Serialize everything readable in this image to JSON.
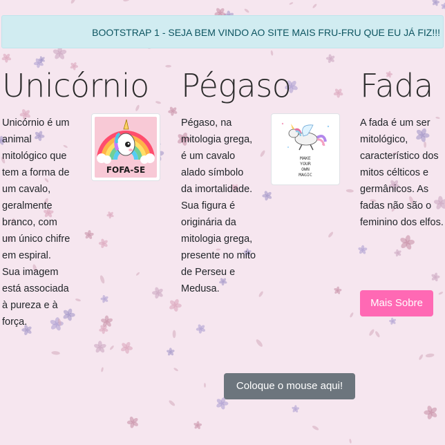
{
  "alert": {
    "text": "BOOTSTRAP 1 - SEJA BEM VINDO AO SITE MAIS FRU-FRU QUE EU JÁ FIZ!!!"
  },
  "columns": [
    {
      "title": "Unicórnio",
      "text": "Unicórnio é um animal mitológico que tem a forma de um cavalo, geralmente branco, com um único chifre em espiral. Sua imagem está associada à pureza e à força."
    },
    {
      "title": "Pégaso",
      "text": "Pégaso, na mitologia grega, é um cavalo alado símbolo da imortalidade. Sua figura é originária da mitologia grega, presente no mito de Perseu e Medusa."
    },
    {
      "title": "Fada",
      "text": "A fada é um ser mitológico, característico dos mitos célticos e germânicos. As fadas não são o feminino dos elfos."
    }
  ],
  "images": {
    "unicorn_caption": "FOFA-SE",
    "pegasus_caption_lines": [
      "MAKE",
      "YOUR",
      "OWN",
      "MAGIC"
    ]
  },
  "buttons": {
    "more": "Mais Sobre",
    "hover": "Coloque o mouse aqui!"
  },
  "colors": {
    "background": "#f6e6ef",
    "alert_bg": "#d1ecf1",
    "alert_text": "#0c5460",
    "btn_pink": "#ff69b4",
    "btn_gray": "#6c757d"
  },
  "icons": {
    "background": "floral-pattern",
    "unicorn_thumb": "unicorn-rainbow-image",
    "pegasus_thumb": "pegasus-image"
  }
}
